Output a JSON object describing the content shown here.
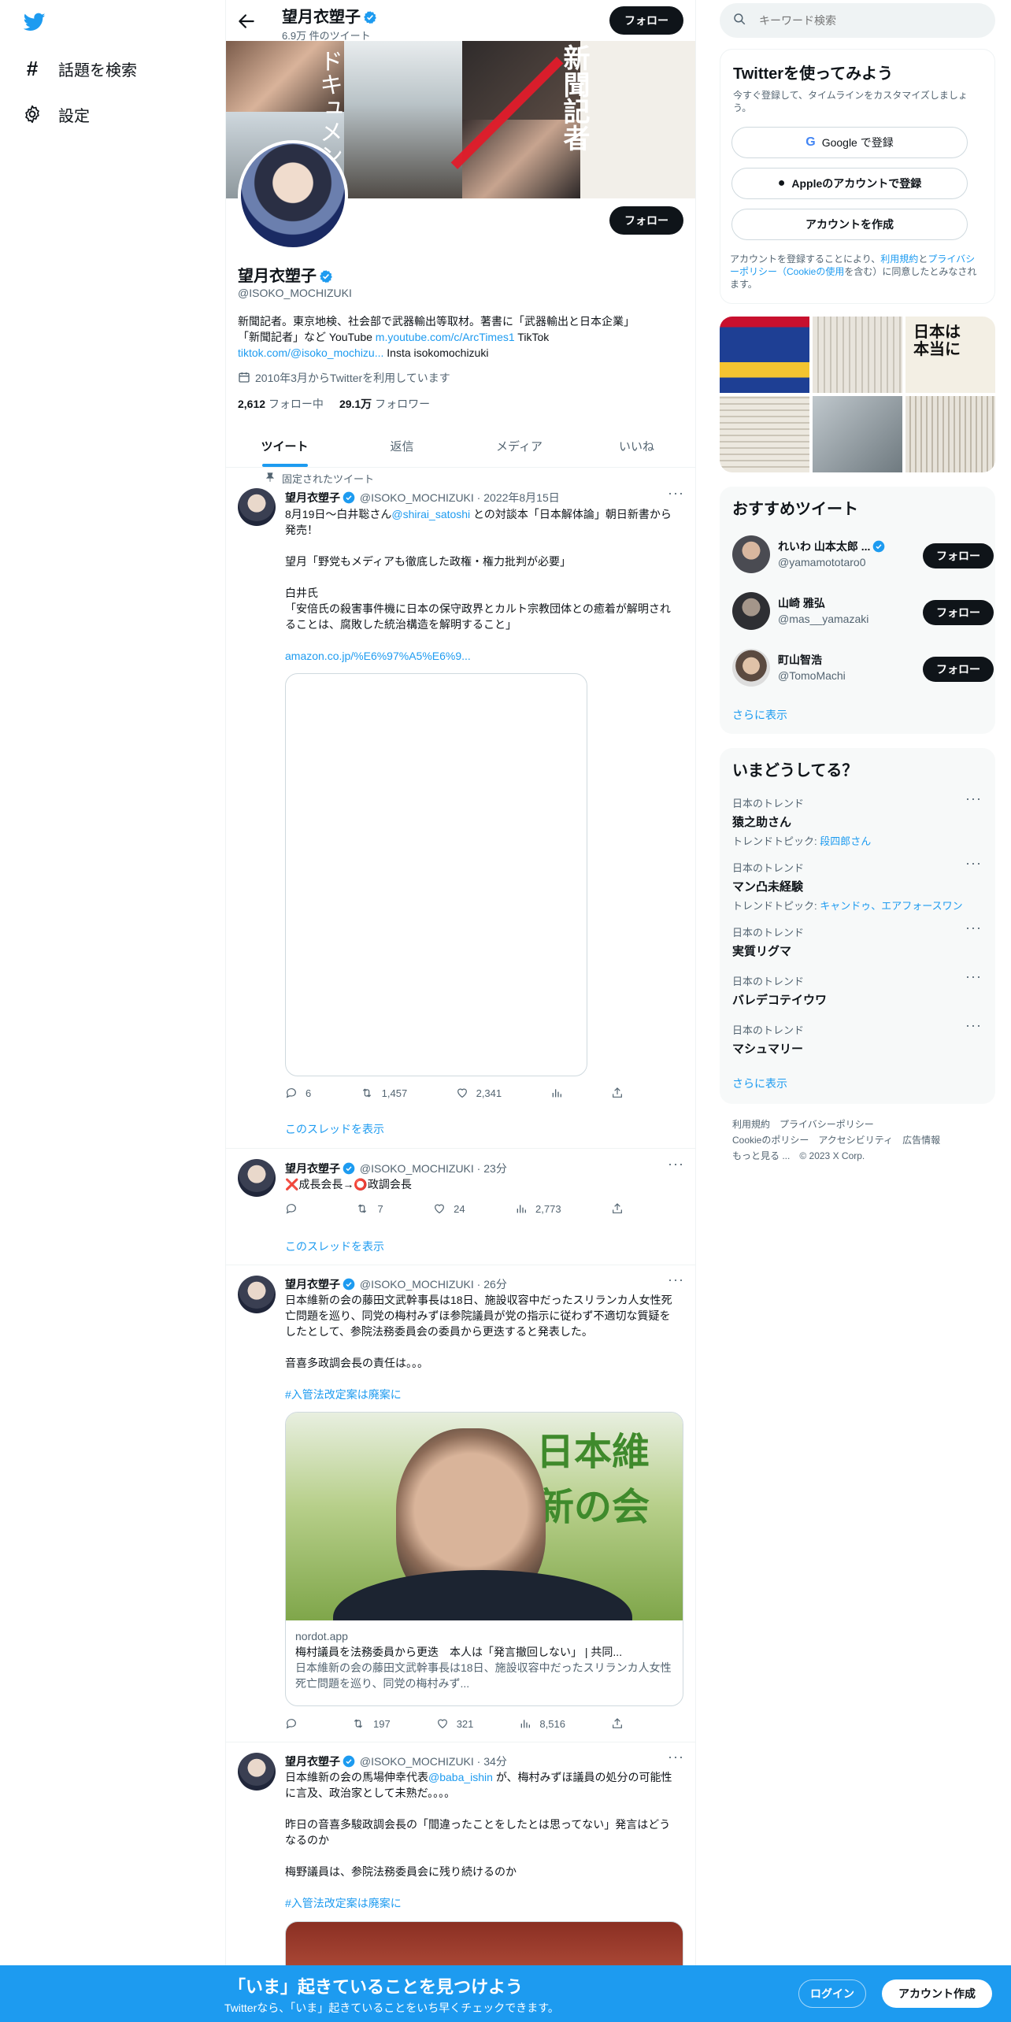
{
  "nav": {
    "explore": "話題を検索",
    "settings": "設定"
  },
  "header": {
    "name": "望月衣塑子",
    "tweet_count": "6.9万 件のツイート",
    "follow": "フォロー"
  },
  "profile": {
    "name": "望月衣塑子",
    "handle": "@ISOKO_MOCHIZUKI",
    "follow": "フォロー",
    "bio_line1": "新聞記者。東京地検、社会部で武器輸出等取材。著書に「武器輸出と日本企業」",
    "bio_line2a": "「新聞記者」など YouTube ",
    "bio_link1": "m.youtube.com/c/ArcTimes1",
    "bio_line2b": " TikTok",
    "bio_link2": "tiktok.com/@isoko_mochizu...",
    "bio_line3": " Insta isokomochizuki",
    "joined": "2010年3月からTwitterを利用しています",
    "following_count": "2,612",
    "following_label": "フォロー中",
    "followers_count": "29.1万",
    "followers_label": "フォロワー",
    "banner_text_1": "新聞記者",
    "banner_text_2": "ドキュメン"
  },
  "tabs": [
    "ツイート",
    "返信",
    "メディア",
    "いいね"
  ],
  "tweets": [
    {
      "pinned_label": "固定されたツイート",
      "name": "望月衣塑子",
      "handle": "@ISOKO_MOCHIZUKI",
      "time": "2022年8月15日",
      "text1a": "8月19日〜白井聡さん",
      "mention": "@shirai_satoshi",
      "text1b": " との対談本「日本解体論」朝日新書から発売！",
      "text2": "望月「野党もメディアも徹底した政権・権力批判が必要」",
      "text3": "白井氏",
      "text4": "「安倍氏の殺害事件機に日本の保守政界とカルト宗教団体との癒着が解明されることは、腐敗した統治構造を解明すること」",
      "link": "amazon.co.jp/%E6%97%A5%E6%9...",
      "replies": "6",
      "retweets": "1,457",
      "likes": "2,341",
      "thread": "このスレッドを表示"
    },
    {
      "name": "望月衣塑子",
      "handle": "@ISOKO_MOCHIZUKI",
      "time": "23分",
      "text": "❌成長会長→⭕️政調会長",
      "replies": "",
      "retweets": "7",
      "likes": "24",
      "views": "2,773",
      "thread": "このスレッドを表示"
    },
    {
      "name": "望月衣塑子",
      "handle": "@ISOKO_MOCHIZUKI",
      "time": "26分",
      "text1": "日本維新の会の藤田文武幹事長は18日、施設収容中だったスリランカ人女性死亡問題を巡り、同党の梅村みずほ参院議員が党の指示に従わず不適切な質疑をしたとして、参院法務委員会の委員から更迭すると発表した。",
      "text2": "音喜多政調会長の責任は。。。",
      "hashtag": "#入管法改定案は廃案に",
      "card_domain": "nordot.app",
      "card_title": "梅村議員を法務委員から更迭　本人は「発言撤回しない」 | 共同...",
      "card_desc": "日本維新の会の藤田文武幹事長は18日、施設収容中だったスリランカ人女性死亡問題を巡り、同党の梅村みず...",
      "card_sign": "日本維新の会",
      "replies": "",
      "retweets": "197",
      "likes": "321",
      "views": "8,516"
    },
    {
      "name": "望月衣塑子",
      "handle": "@ISOKO_MOCHIZUKI",
      "time": "34分",
      "text1a": "日本維新の会の馬場伸幸代表",
      "mention": "@baba_ishin",
      "text1b": " が、梅村みずほ議員の処分の可能性に言及、政治家として未熟だ。。。。",
      "text2": "昨日の音喜多駿政調会長の「間違ったことをしたとは思ってない」発言はどうなるのか",
      "text3": "梅野議員は、参院法務委員会に残り続けるのか",
      "hashtag": "#入管法改定案は廃案に"
    }
  ],
  "search": {
    "placeholder": "キーワード検索"
  },
  "signup": {
    "title": "Twitterを使ってみよう",
    "subtitle": "今すぐ登録して、タイムラインをカスタマイズしましょう。",
    "google": "Google で登録",
    "apple": "Appleのアカウントで登録",
    "create": "アカウントを作成",
    "terms_a": "アカウントを登録することにより、",
    "terms_link1": "利用規約",
    "terms_b": "と",
    "terms_link2": "プライバシーポリシー（Cookieの使用",
    "terms_c": "を含む）に同意したとみなされます。"
  },
  "recommended": {
    "title": "おすすめツイート",
    "users": [
      {
        "name": "れいわ 山本太郎 ...",
        "handle": "@yamamototaro0",
        "verified": true
      },
      {
        "name": "山崎 雅弘",
        "handle": "@mas__yamazaki",
        "verified": false
      },
      {
        "name": "町山智浩",
        "handle": "@TomoMachi",
        "verified": false
      }
    ],
    "follow": "フォロー",
    "more": "さらに表示"
  },
  "trends": {
    "title": "いまどうしてる？",
    "items": [
      {
        "kicker": "日本のトレンド",
        "title": "猿之助さん",
        "sub_label": "トレンドトピック: ",
        "sub_link": "段四郎さん"
      },
      {
        "kicker": "日本のトレンド",
        "title": "マン凸未経験",
        "sub_label": "トレンドトピック: ",
        "sub_link": "キャンドゥ、エアフォースワン"
      },
      {
        "kicker": "日本のトレンド",
        "title": "実質リグマ",
        "sub_label": "",
        "sub_link": ""
      },
      {
        "kicker": "日本のトレンド",
        "title": "バレデコテイウワ",
        "sub_label": "",
        "sub_link": ""
      },
      {
        "kicker": "日本のトレンド",
        "title": "マシュマリー",
        "sub_label": "",
        "sub_link": ""
      }
    ],
    "more": "さらに表示"
  },
  "footer": {
    "line1": [
      "利用規約",
      "プライバシーポリシー"
    ],
    "line2": [
      "Cookieのポリシー",
      "アクセシビリティ",
      "広告情報"
    ],
    "more": "もっと見る ...",
    "copyright": "© 2023 X Corp."
  },
  "bottom_bar": {
    "title": "「いま」起きていることを見つけよう",
    "subtitle": "Twitterなら、「いま」起きていることをいち早くチェックできます。",
    "login": "ログイン",
    "signup": "アカウント作成"
  },
  "colors": {
    "accent": "#1d9bf0",
    "bottom_bar": "#1d9bf0",
    "text": "#0f1419",
    "muted": "#536471"
  }
}
